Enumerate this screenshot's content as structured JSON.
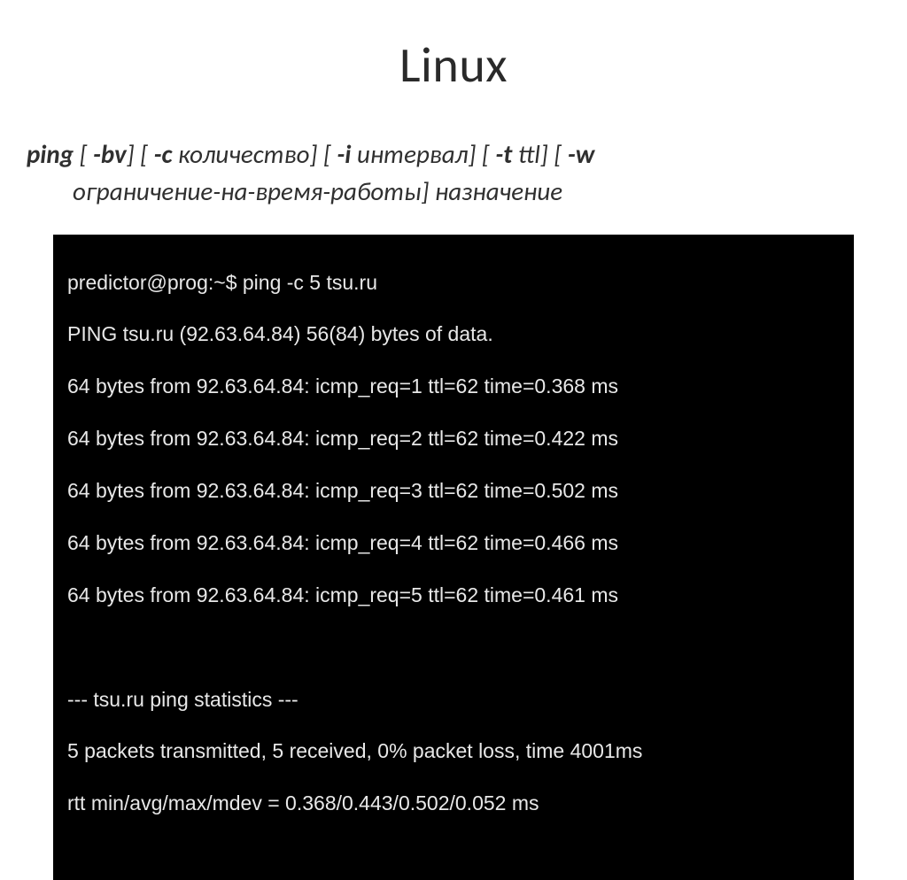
{
  "title": "Linux",
  "syntax": {
    "line1_parts": {
      "p1": "ping",
      "p2": " [ ",
      "p3": "-bv",
      "p4": "] [ ",
      "p5": "-c",
      "p6": " количество] [ ",
      "p7": "-i",
      "p8": " интервал] [ ",
      "p9": "-t",
      "p10": " ttl] [ ",
      "p11": "-w"
    },
    "line2": "ограничение-на-время-работы] назначение"
  },
  "terminal": {
    "lines": [
      "predictor@prog:~$ ping -c 5 tsu.ru",
      "PING tsu.ru (92.63.64.84) 56(84) bytes of data.",
      "64 bytes from 92.63.64.84: icmp_req=1 ttl=62 time=0.368 ms",
      "64 bytes from 92.63.64.84: icmp_req=2 ttl=62 time=0.422 ms",
      "64 bytes from 92.63.64.84: icmp_req=3 ttl=62 time=0.502 ms",
      "64 bytes from 92.63.64.84: icmp_req=4 ttl=62 time=0.466 ms",
      "64 bytes from 92.63.64.84: icmp_req=5 ttl=62 time=0.461 ms",
      "",
      "--- tsu.ru ping statistics ---",
      "5 packets transmitted, 5 received, 0% packet loss, time 4001ms",
      "rtt min/avg/max/mdev = 0.368/0.443/0.502/0.052 ms"
    ]
  }
}
